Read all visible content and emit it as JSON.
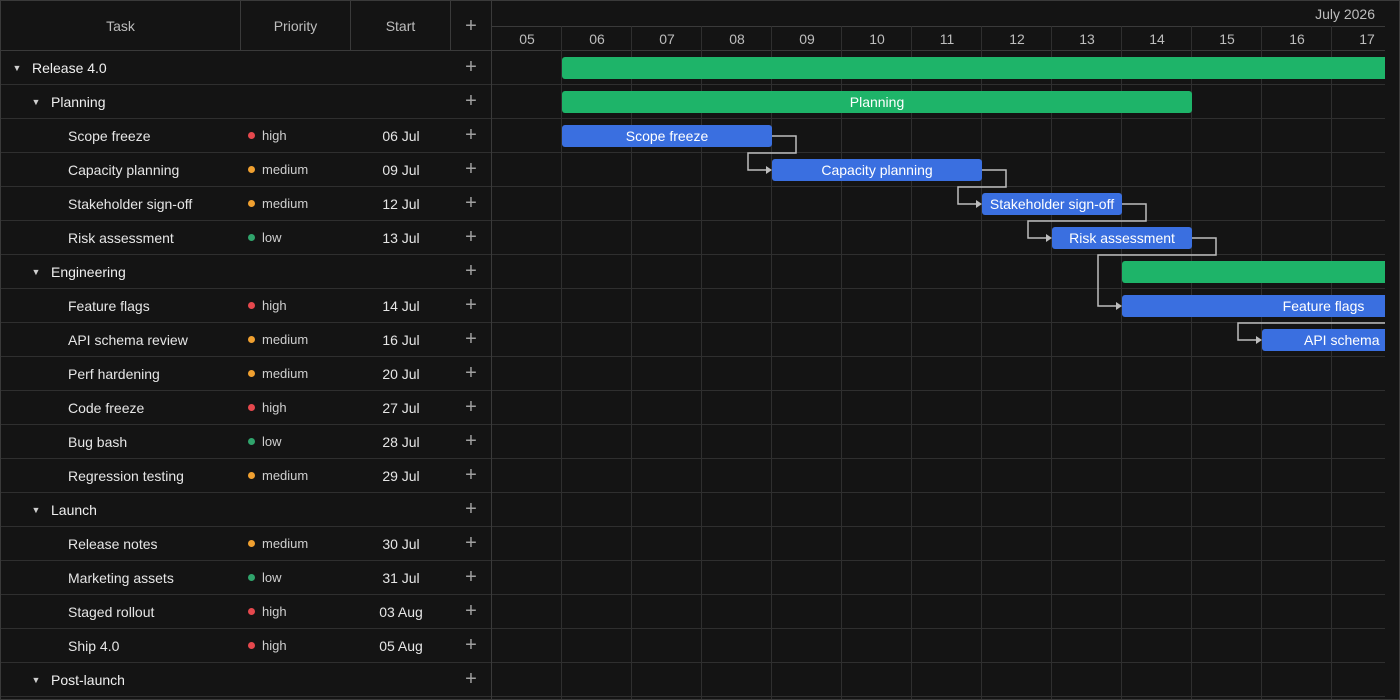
{
  "header": {
    "task": "Task",
    "priority": "Priority",
    "start": "Start",
    "add": "+"
  },
  "timeline": {
    "month": "July 2026",
    "days": [
      "05",
      "06",
      "07",
      "08",
      "09",
      "10",
      "11",
      "12",
      "13",
      "14",
      "15",
      "16",
      "17"
    ]
  },
  "rows": [
    {
      "level": 0,
      "type": "group",
      "name": "Release 4.0",
      "priority": "",
      "start": ""
    },
    {
      "level": 1,
      "type": "group",
      "name": "Planning",
      "priority": "",
      "start": ""
    },
    {
      "level": 2,
      "type": "task",
      "name": "Scope freeze",
      "priority": "high",
      "start": "06 Jul"
    },
    {
      "level": 2,
      "type": "task",
      "name": "Capacity planning",
      "priority": "medium",
      "start": "09 Jul"
    },
    {
      "level": 2,
      "type": "task",
      "name": "Stakeholder sign-off",
      "priority": "medium",
      "start": "12 Jul"
    },
    {
      "level": 2,
      "type": "task",
      "name": "Risk assessment",
      "priority": "low",
      "start": "13 Jul"
    },
    {
      "level": 1,
      "type": "group",
      "name": "Engineering",
      "priority": "",
      "start": ""
    },
    {
      "level": 2,
      "type": "task",
      "name": "Feature flags",
      "priority": "high",
      "start": "14 Jul"
    },
    {
      "level": 2,
      "type": "task",
      "name": "API schema review",
      "priority": "medium",
      "start": "16 Jul"
    },
    {
      "level": 2,
      "type": "task",
      "name": "Perf hardening",
      "priority": "medium",
      "start": "20 Jul"
    },
    {
      "level": 2,
      "type": "task",
      "name": "Code freeze",
      "priority": "high",
      "start": "27 Jul"
    },
    {
      "level": 2,
      "type": "task",
      "name": "Bug bash",
      "priority": "low",
      "start": "28 Jul"
    },
    {
      "level": 2,
      "type": "task",
      "name": "Regression testing",
      "priority": "medium",
      "start": "29 Jul"
    },
    {
      "level": 1,
      "type": "group",
      "name": "Launch",
      "priority": "",
      "start": ""
    },
    {
      "level": 2,
      "type": "task",
      "name": "Release notes",
      "priority": "medium",
      "start": "30 Jul"
    },
    {
      "level": 2,
      "type": "task",
      "name": "Marketing assets",
      "priority": "low",
      "start": "31 Jul"
    },
    {
      "level": 2,
      "type": "task",
      "name": "Staged rollout",
      "priority": "high",
      "start": "03 Aug"
    },
    {
      "level": 2,
      "type": "task",
      "name": "Ship 4.0",
      "priority": "high",
      "start": "05 Aug"
    },
    {
      "level": 1,
      "type": "group",
      "name": "Post-launch",
      "priority": "",
      "start": ""
    }
  ],
  "bars": [
    {
      "row": 0,
      "kind": "summary",
      "label": "",
      "start_day": "06",
      "end_day": "18+"
    },
    {
      "row": 1,
      "kind": "summary",
      "label": "Planning",
      "start_day": "06",
      "end_day": "14"
    },
    {
      "row": 2,
      "kind": "task",
      "label": "Scope freeze",
      "start_day": "06",
      "end_day": "08"
    },
    {
      "row": 3,
      "kind": "task",
      "label": "Capacity planning",
      "start_day": "09",
      "end_day": "11"
    },
    {
      "row": 4,
      "kind": "task",
      "label": "Stakeholder sign-off",
      "start_day": "12",
      "end_day": "13"
    },
    {
      "row": 5,
      "kind": "task",
      "label": "Risk assessment",
      "start_day": "13",
      "end_day": "14"
    },
    {
      "row": 6,
      "kind": "summary",
      "label": "",
      "start_day": "14",
      "end_day": "18+"
    },
    {
      "row": 7,
      "kind": "task",
      "label": "Feature flags",
      "start_day": "14",
      "end_day": "18+"
    },
    {
      "row": 8,
      "kind": "task",
      "label": "API schema",
      "start_day": "16",
      "end_day": "18+"
    }
  ],
  "colors": {
    "high": "#e5484d",
    "medium": "#f0a030",
    "low": "#30a46c",
    "summary": "#1eb469",
    "task": "#3a6fe0",
    "link": "#bdbdbd"
  }
}
